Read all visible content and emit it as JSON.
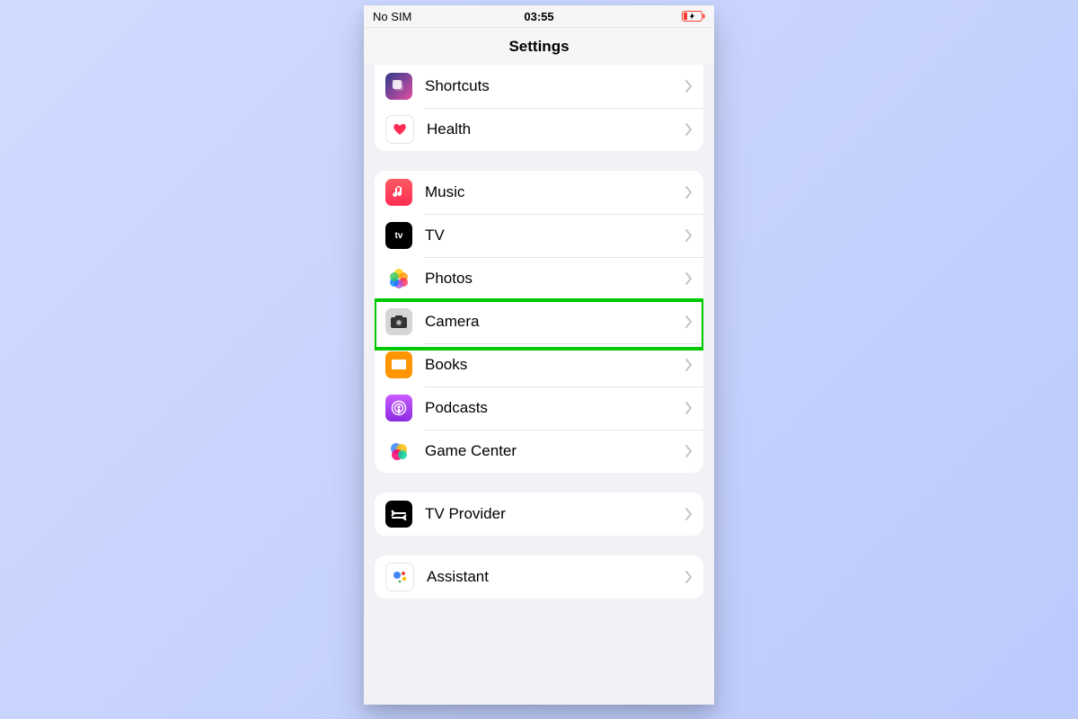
{
  "statusbar": {
    "carrier": "No SIM",
    "time": "03:55"
  },
  "nav": {
    "title": "Settings"
  },
  "groups": [
    {
      "rows": [
        {
          "key": "shortcuts",
          "label": "Shortcuts"
        },
        {
          "key": "health",
          "label": "Health"
        }
      ]
    },
    {
      "rows": [
        {
          "key": "music",
          "label": "Music"
        },
        {
          "key": "tv",
          "label": "TV",
          "icon_text": "tv"
        },
        {
          "key": "photos",
          "label": "Photos"
        },
        {
          "key": "camera",
          "label": "Camera",
          "highlighted": true
        },
        {
          "key": "books",
          "label": "Books"
        },
        {
          "key": "podcasts",
          "label": "Podcasts"
        },
        {
          "key": "gamecenter",
          "label": "Game Center"
        }
      ]
    },
    {
      "rows": [
        {
          "key": "tvprovider",
          "label": "TV Provider"
        }
      ]
    },
    {
      "rows": [
        {
          "key": "assistant",
          "label": "Assistant"
        }
      ]
    }
  ],
  "colors": {
    "highlight": "#00c800"
  }
}
